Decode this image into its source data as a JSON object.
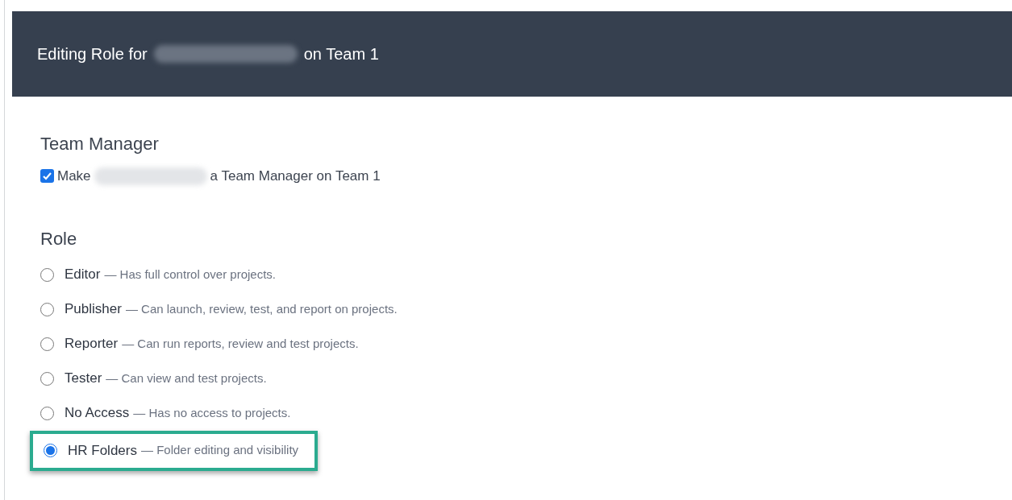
{
  "header": {
    "title_before": "Editing Role for",
    "title_after": "on Team 1"
  },
  "team_manager": {
    "heading": "Team Manager",
    "checkbox": {
      "label_before": "Make",
      "label_after": "a Team Manager on Team 1",
      "checked": true
    }
  },
  "role": {
    "heading": "Role",
    "options": [
      {
        "name": "Editor",
        "description": "— Has full control over projects.",
        "selected": false,
        "highlighted": false
      },
      {
        "name": "Publisher",
        "description": "— Can launch, review, test, and report on projects.",
        "selected": false,
        "highlighted": false
      },
      {
        "name": "Reporter",
        "description": "— Can run reports, review and test projects.",
        "selected": false,
        "highlighted": false
      },
      {
        "name": "Tester",
        "description": "— Can view and test projects.",
        "selected": false,
        "highlighted": false
      },
      {
        "name": "No Access",
        "description": "— Has no access to projects.",
        "selected": false,
        "highlighted": false
      },
      {
        "name": "HR Folders",
        "description": "— Folder editing and visibility",
        "selected": true,
        "highlighted": true
      }
    ]
  }
}
